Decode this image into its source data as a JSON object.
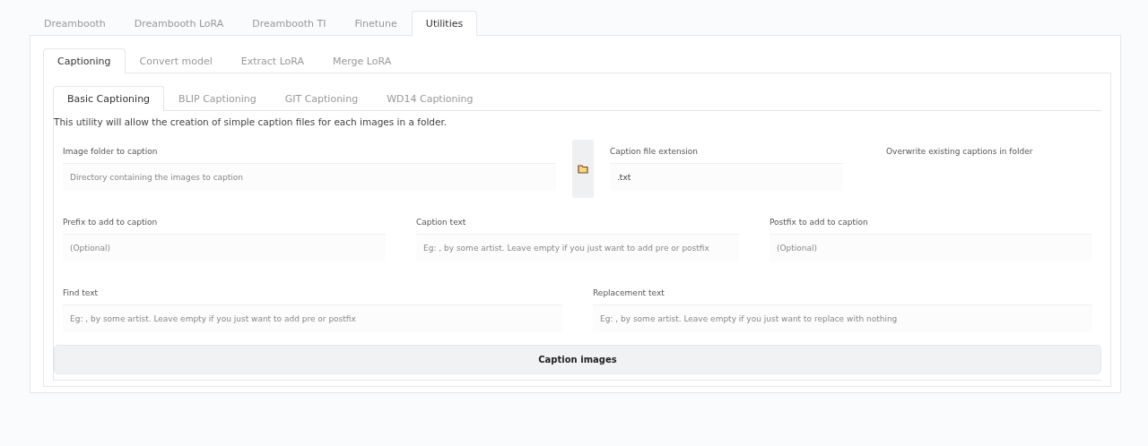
{
  "main_tabs": [
    {
      "label": "Dreambooth",
      "selected": false
    },
    {
      "label": "Dreambooth LoRA",
      "selected": false
    },
    {
      "label": "Dreambooth TI",
      "selected": false
    },
    {
      "label": "Finetune",
      "selected": false
    },
    {
      "label": "Utilities",
      "selected": true
    }
  ],
  "utility_tabs": [
    {
      "label": "Captioning",
      "selected": true
    },
    {
      "label": "Convert model",
      "selected": false
    },
    {
      "label": "Extract LoRA",
      "selected": false
    },
    {
      "label": "Merge LoRA",
      "selected": false
    }
  ],
  "captioning_tabs": [
    {
      "label": "Basic Captioning",
      "selected": true
    },
    {
      "label": "BLIP Captioning",
      "selected": false
    },
    {
      "label": "GIT Captioning",
      "selected": false
    },
    {
      "label": "WD14 Captioning",
      "selected": false
    }
  ],
  "description": "This utility will allow the creation of simple caption files for each images in a folder.",
  "image_folder": {
    "label": "Image folder to caption",
    "placeholder": "Directory containing the images to caption"
  },
  "caption_extension": {
    "label": "Caption file extension",
    "value": ".txt"
  },
  "overwrite": {
    "label": "Overwrite existing captions in folder"
  },
  "row_2": [
    {
      "label": "Prefix to add to caption",
      "placeholder": "(Optional)"
    },
    {
      "label": "Caption text",
      "placeholder": "Eg: , by some artist. Leave empty if you just want to add pre or postfix"
    },
    {
      "label": "Postfix to add to caption",
      "placeholder": "(Optional)"
    }
  ],
  "row_3": [
    {
      "label": "Find text",
      "placeholder": "Eg: , by some artist. Leave empty if you just want to add pre or postfix"
    },
    {
      "label": "Replacement text",
      "placeholder": "Eg: , by some artist. Leave empty if you just want to replace with nothing"
    }
  ],
  "button": "Caption images"
}
